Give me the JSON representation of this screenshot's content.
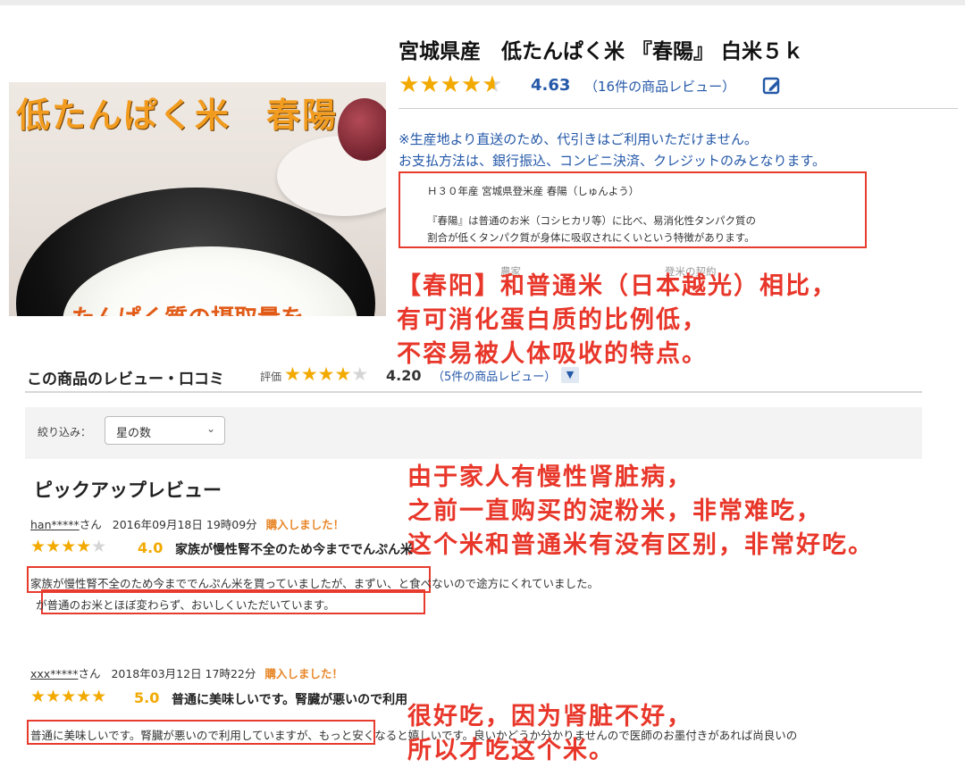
{
  "image": {
    "overlay_title": "低たんぱく米　春陽",
    "overlay_bottom": "たんぱく質の摂取量を"
  },
  "product": {
    "title": "宮城県産　低たんぱく米 『春陽』 白米５ｋ",
    "rating": 4.63,
    "rating_text": "4.63",
    "review_count": "（16件の商品レビュー）",
    "edit_icon": "edit-review-icon",
    "note1": "※生産地より直送のため、代引きはご利用いただけません。",
    "note2": "お支払方法は、銀行振込、コンビニ決済、クレジットのみとなります。",
    "desc_line1": "Ｈ３０年産 宮城県登米産 春陽（しゅんよう）",
    "desc_line2": "『春陽』は普通のお米（コシヒカリ等）に比べ、易消化性タンパク質の",
    "desc_line3": "割合が低くタンパク質が身体に吸収されにくいという特徴があります。",
    "desc_faded": "農家　　　　　　　　　　　　　　登米の契約"
  },
  "annotations": {
    "a1_line1": "【春阳】和普通米（日本越光）相比，",
    "a1_line2": "有可消化蛋白质的比例低，",
    "a1_line3": "不容易被人体吸收的特点。",
    "a2_line1": "由于家人有慢性肾脏病，",
    "a2_line2": "之前一直购买的淀粉米，非常难吃，",
    "a2_line3": "这个米和普通米有没有区别，非常好吃。",
    "a3_line1": "很好吃，因为肾脏不好，",
    "a3_line2": "所以才吃这个米。",
    "color": "#e8372a"
  },
  "reviews_section": {
    "heading": "この商品のレビュー・口コミ",
    "eval_label": "評価",
    "rating": 4.2,
    "rating_text": "4.20",
    "count": "（5件の商品レビュー）",
    "expand_icon": "chevron-down-icon",
    "filter_label": "絞り込み：",
    "filter_value": "星の数",
    "pickup_heading": "ピックアップレビュー"
  },
  "reviews": [
    {
      "user": "han*****",
      "san": "さん",
      "date": "2016年09月18日 19時09分",
      "bought": "購入しました！",
      "stars": 4,
      "score": "4.0",
      "title": "家族が慢性腎不全のため今まででんぷん米",
      "body1": "家族が慢性腎不全のため今まででんぷん米を買っていましたが、まずい、と食べないので途方にくれていました。",
      "body2": "が普通のお米とほぼ変わらず、おいしくいただいています。"
    },
    {
      "user": "xxx*****",
      "san": "さん",
      "date": "2018年03月12日 17時22分",
      "bought": "購入しました！",
      "stars": 5,
      "score": "5.0",
      "title": "普通に美味しいです。腎臓が悪いので利用",
      "body1": "普通に美味しいです。腎臓が悪いので利用していますが、もっと安くなると嬉しいです。良いかどうか分かりませんので医師のお墨付きがあれば尚良いの"
    }
  ]
}
